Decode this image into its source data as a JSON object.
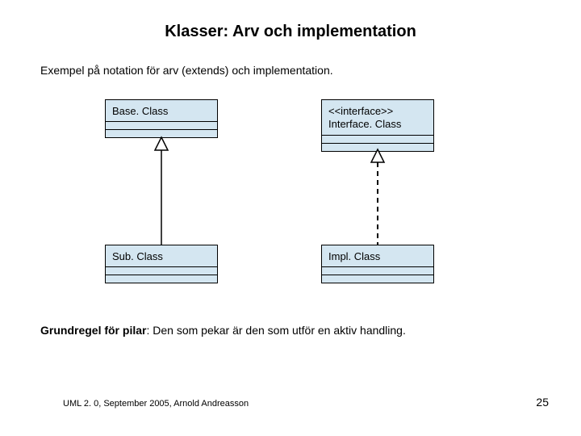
{
  "title": "Klasser: Arv och implementation",
  "intro": "Exempel på notation för arv (extends) och implementation.",
  "boxes": {
    "base": {
      "name": "Base. Class"
    },
    "sub": {
      "name": "Sub. Class"
    },
    "iface": {
      "stereotype": "<<interface>>",
      "name": "Interface. Class"
    },
    "impl": {
      "name": "Impl. Class"
    }
  },
  "rule": {
    "label": "Grundregel för pilar",
    "text": ": Den som pekar är den som utför en aktiv handling."
  },
  "footer": {
    "credit": "UML 2. 0, September 2005, Arnold Andreasson",
    "page": "25"
  }
}
